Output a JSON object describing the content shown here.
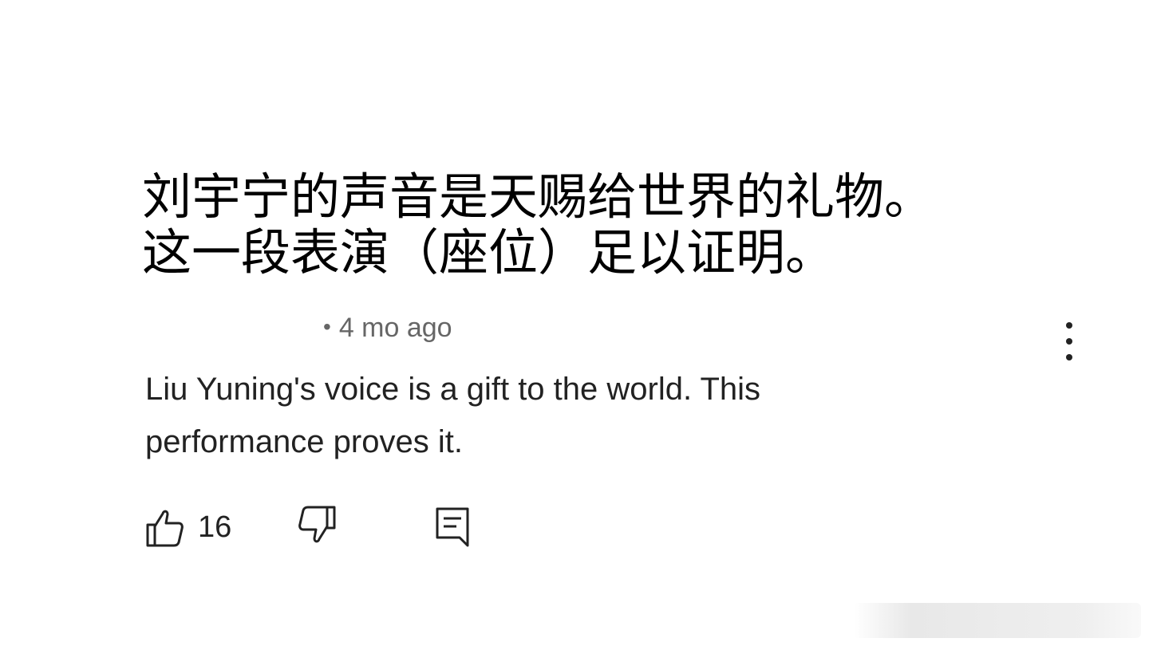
{
  "caption": {
    "line1": "刘宇宁的声音是天赐给世界的礼物。",
    "line2": "这一段表演（座位）足以证明。"
  },
  "comment": {
    "meta_separator": "•",
    "time_ago": "4 mo ago",
    "text_line1": "Liu Yuning's voice is a gift to the world. This",
    "text_line2": "performance proves it.",
    "like_count": "16"
  },
  "icons": {
    "more": "more-vertical-icon",
    "like": "thumbs-up-icon",
    "dislike": "thumbs-down-icon",
    "reply": "reply-comment-icon"
  },
  "colors": {
    "text_primary": "#222222",
    "text_secondary": "#666666",
    "caption": "#000000",
    "background": "#ffffff"
  }
}
